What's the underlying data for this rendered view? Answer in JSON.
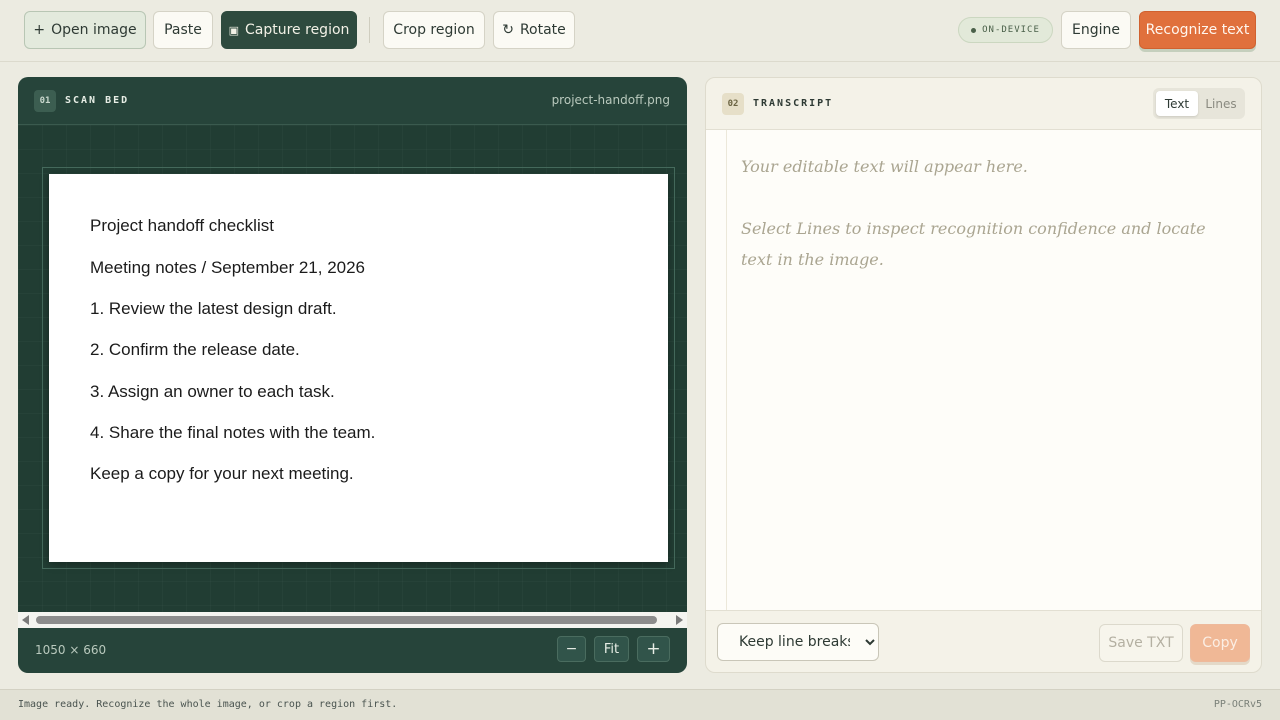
{
  "toolbar": {
    "open_image": "Open image",
    "open_icon": "+",
    "paste": "Paste",
    "capture_region": "Capture region",
    "capture_icon": "▣",
    "crop_region": "Crop region",
    "rotate": "Rotate",
    "rotate_icon": "↻",
    "badge": "ON-DEVICE",
    "engine": "Engine",
    "recognize": "Recognize text"
  },
  "scan_bed": {
    "number": "01",
    "title": "SCAN BED",
    "file_name": "project-handoff.png",
    "document_lines": [
      "Project handoff checklist",
      "Meeting notes / September 21, 2026",
      "1. Review the latest design draft.",
      "2. Confirm the release date.",
      "3. Assign an owner to each task.",
      "4. Share the final notes with the team.",
      "Keep a copy for your next meeting."
    ],
    "dimensions": "1050 × 660",
    "zoom_out": "−",
    "zoom_fit": "Fit",
    "zoom_in": "+"
  },
  "transcript": {
    "number": "02",
    "title": "TRANSCRIPT",
    "tab_text": "Text",
    "tab_lines": "Lines",
    "placeholder_1": "Your editable text will appear here.",
    "placeholder_2": "Select Lines to inspect recognition confidence and locate text in the image.",
    "line_mode": "Keep line breaks",
    "save_txt": "Save TXT",
    "copy": "Copy"
  },
  "status": {
    "message": "Image ready. Recognize the whole image, or crop a region first.",
    "engine": "PP-OCRv5"
  },
  "colors": {
    "accent": "#e0703c",
    "panel_dark": "#26443a",
    "background": "#ecebe1"
  }
}
